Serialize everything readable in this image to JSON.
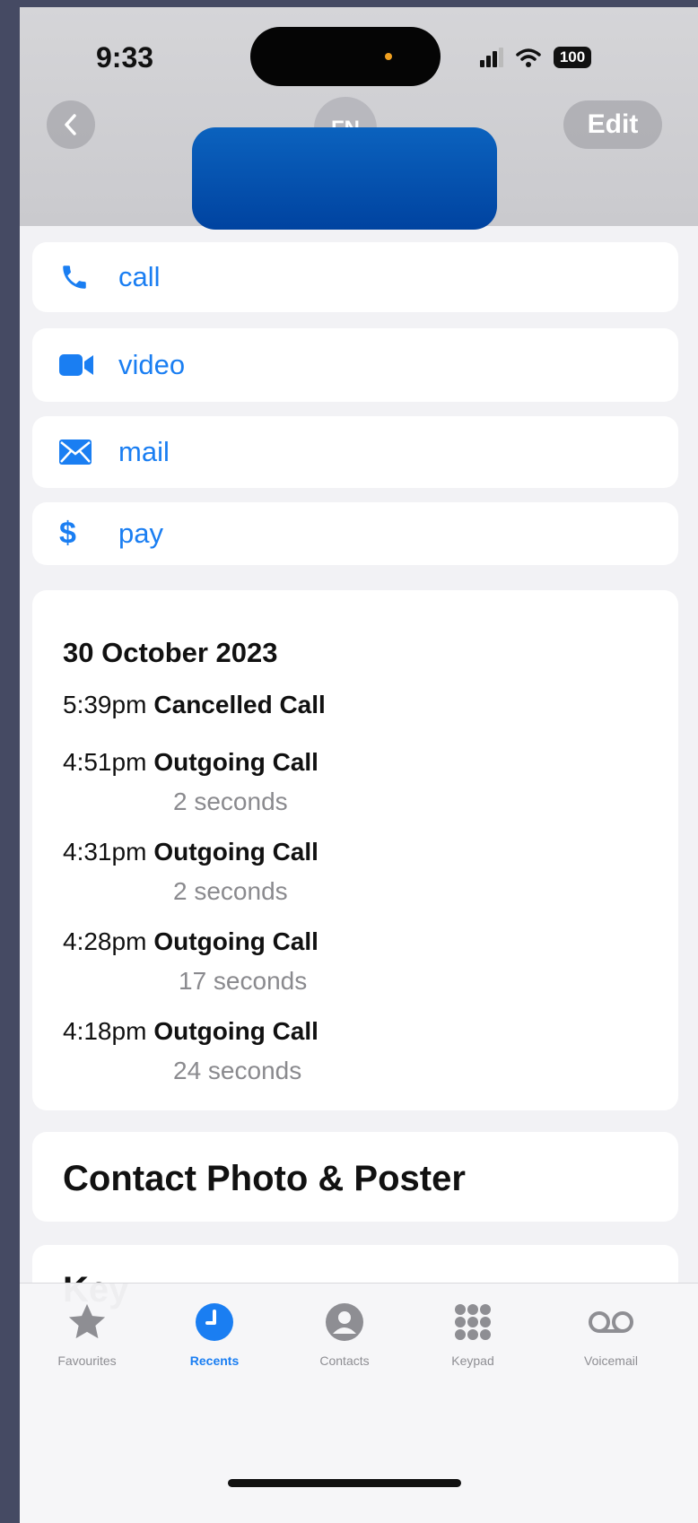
{
  "status_bar": {
    "time": "9:33",
    "battery": "100"
  },
  "header": {
    "avatar_initials": "FN",
    "edit_label": "Edit"
  },
  "actions": [
    {
      "label": "call",
      "icon": "phone-icon"
    },
    {
      "label": "video",
      "icon": "video-camera-icon"
    },
    {
      "label": "mail",
      "icon": "envelope-icon"
    },
    {
      "label": "pay",
      "icon": "dollar-icon"
    }
  ],
  "history": {
    "date": "30 October 2023",
    "calls": [
      {
        "time": "5:39pm",
        "type": "Cancelled Call",
        "duration": ""
      },
      {
        "time": "4:51pm",
        "type": "Outgoing Call",
        "duration": "2 seconds"
      },
      {
        "time": "4:31pm",
        "type": "Outgoing Call",
        "duration": "2 seconds"
      },
      {
        "time": "4:28pm",
        "type": "Outgoing Call",
        "duration": "17 seconds"
      },
      {
        "time": "4:18pm",
        "type": "Outgoing Call",
        "duration": "24 seconds"
      }
    ]
  },
  "sections": {
    "contact_photo_poster": "Contact Photo & Poster",
    "key_partial": "Key"
  },
  "tabbar": {
    "tabs": [
      {
        "label": "Favourites",
        "icon": "star-icon",
        "active": false
      },
      {
        "label": "Recents",
        "icon": "clock-icon",
        "active": true
      },
      {
        "label": "Contacts",
        "icon": "person-icon",
        "active": false
      },
      {
        "label": "Keypad",
        "icon": "keypad-icon",
        "active": false
      },
      {
        "label": "Voicemail",
        "icon": "voicemail-icon",
        "active": false
      }
    ]
  },
  "colors": {
    "accent": "#1a7ef2",
    "background": "#f2f2f5",
    "redaction": "#0052b4"
  }
}
